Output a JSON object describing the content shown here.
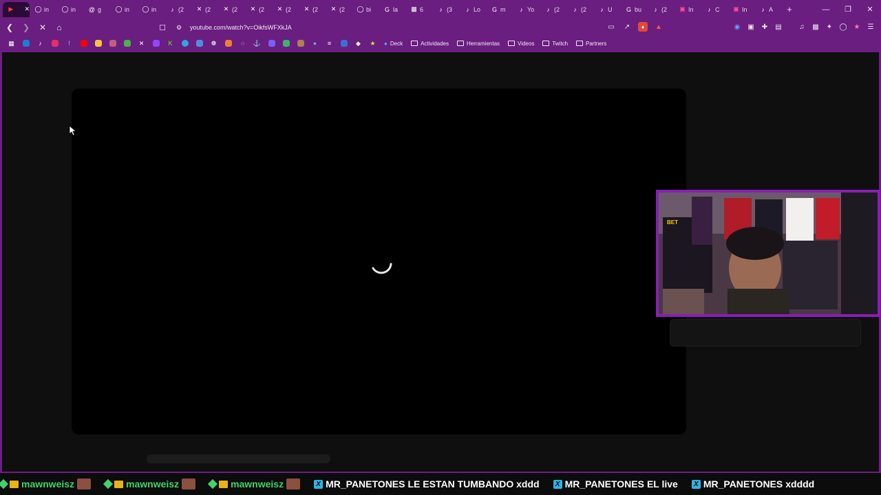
{
  "tabs": [
    {
      "icon": "youtube-icon",
      "title": "",
      "active": true
    },
    {
      "icon": "globe-icon",
      "title": "in"
    },
    {
      "icon": "globe-icon",
      "title": "in"
    },
    {
      "icon": "threads-icon",
      "title": "g"
    },
    {
      "icon": "globe-icon",
      "title": "in"
    },
    {
      "icon": "globe-icon",
      "title": "in"
    },
    {
      "icon": "tiktok-icon",
      "title": "(2"
    },
    {
      "icon": "x-icon",
      "title": "(2"
    },
    {
      "icon": "x-icon",
      "title": "(2"
    },
    {
      "icon": "x-icon",
      "title": "(2"
    },
    {
      "icon": "x-icon",
      "title": "(2"
    },
    {
      "icon": "x-icon",
      "title": "(2"
    },
    {
      "icon": "x-icon",
      "title": "(2"
    },
    {
      "icon": "globe-icon",
      "title": "bi"
    },
    {
      "icon": "google-icon",
      "title": "la"
    },
    {
      "icon": "news-icon",
      "title": "6"
    },
    {
      "icon": "tiktok-icon",
      "title": "(3"
    },
    {
      "icon": "tiktok-icon",
      "title": "Lo"
    },
    {
      "icon": "google-icon",
      "title": "m"
    },
    {
      "icon": "tiktok-icon",
      "title": "Yo"
    },
    {
      "icon": "tiktok-icon",
      "title": "(2"
    },
    {
      "icon": "tiktok-icon",
      "title": "(2"
    },
    {
      "icon": "tiktok-icon",
      "title": "U"
    },
    {
      "icon": "google-icon",
      "title": "bu"
    },
    {
      "icon": "tiktok-icon",
      "title": "(2"
    },
    {
      "icon": "instagram-icon",
      "title": "In"
    },
    {
      "icon": "tiktok-icon",
      "title": "C"
    },
    {
      "icon": "instagram-icon",
      "title": "In"
    },
    {
      "icon": "tiktok-icon",
      "title": "A"
    }
  ],
  "address_bar": {
    "url": "youtube.com/watch?v=OikfsWFXkJA"
  },
  "bookmarks": {
    "folders": [
      "Deck",
      "Actividades",
      "Herramientas",
      "Videos",
      "Twitch",
      "Partners"
    ]
  },
  "ticker": [
    {
      "user": "mawnweisz",
      "message": "",
      "color": "#3fd36b"
    },
    {
      "user": "mawnweisz",
      "message": "",
      "color": "#3fd36b"
    },
    {
      "user": "mawnweisz",
      "message": "",
      "color": "#3fd36b"
    },
    {
      "user": "MR_PANETONES",
      "message": "LE ESTAN TUMBANDO xddd",
      "color": "#ffffff"
    },
    {
      "user": "MR_PANETONES",
      "message": "EL live",
      "color": "#ffffff"
    },
    {
      "user": "MR_PANETONES",
      "message": "xdddd",
      "color": "#ffffff"
    }
  ]
}
